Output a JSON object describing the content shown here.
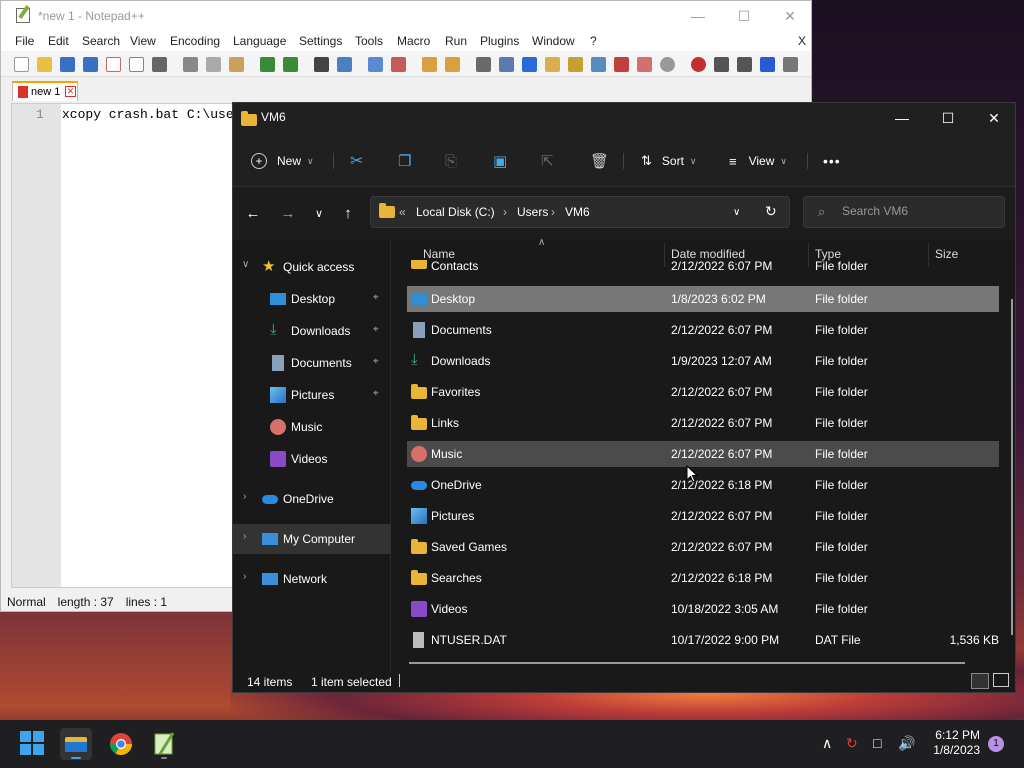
{
  "notepad": {
    "title": "*new 1 - Notepad++",
    "menu": [
      "File",
      "Edit",
      "Search",
      "View",
      "Encoding",
      "Language",
      "Settings",
      "Tools",
      "Macro",
      "Run",
      "Plugins",
      "Window",
      "?"
    ],
    "menu_close": "X",
    "tab_label": "new 1",
    "line_number": "1",
    "code": "xcopy crash.bat C:\\use",
    "status_mode": "Normal",
    "status_length": "length : 37",
    "status_lines": "lines : 1"
  },
  "explorer": {
    "title": "VM6",
    "toolbar": {
      "new_label": "New",
      "sort_label": "Sort",
      "view_label": "View",
      "more_label": "•••"
    },
    "breadcrumb": {
      "chevron": "«",
      "parts": [
        "Local Disk (C:)",
        "Users",
        "VM6"
      ]
    },
    "search_placeholder": "Search VM6",
    "columns": {
      "name": "Name",
      "date": "Date modified",
      "type": "Type",
      "size": "Size"
    },
    "nav": {
      "quick_access": "Quick access",
      "items": [
        "Desktop",
        "Downloads",
        "Documents",
        "Pictures",
        "Music",
        "Videos"
      ],
      "onedrive": "OneDrive",
      "my_computer": "My Computer",
      "network": "Network"
    },
    "files": [
      {
        "name": "Contacts",
        "date": "2/12/2022 6:07 PM",
        "type": "File folder",
        "size": ""
      },
      {
        "name": "Desktop",
        "date": "1/8/2023 6:02 PM",
        "type": "File folder",
        "size": ""
      },
      {
        "name": "Documents",
        "date": "2/12/2022 6:07 PM",
        "type": "File folder",
        "size": ""
      },
      {
        "name": "Downloads",
        "date": "1/9/2023 12:07 AM",
        "type": "File folder",
        "size": ""
      },
      {
        "name": "Favorites",
        "date": "2/12/2022 6:07 PM",
        "type": "File folder",
        "size": ""
      },
      {
        "name": "Links",
        "date": "2/12/2022 6:07 PM",
        "type": "File folder",
        "size": ""
      },
      {
        "name": "Music",
        "date": "2/12/2022 6:07 PM",
        "type": "File folder",
        "size": ""
      },
      {
        "name": "OneDrive",
        "date": "2/12/2022 6:18 PM",
        "type": "File folder",
        "size": ""
      },
      {
        "name": "Pictures",
        "date": "2/12/2022 6:07 PM",
        "type": "File folder",
        "size": ""
      },
      {
        "name": "Saved Games",
        "date": "2/12/2022 6:07 PM",
        "type": "File folder",
        "size": ""
      },
      {
        "name": "Searches",
        "date": "2/12/2022 6:18 PM",
        "type": "File folder",
        "size": ""
      },
      {
        "name": "Videos",
        "date": "10/18/2022 3:05 AM",
        "type": "File folder",
        "size": ""
      },
      {
        "name": "NTUSER.DAT",
        "date": "10/17/2022 9:00 PM",
        "type": "DAT File",
        "size": "1,536 KB"
      }
    ],
    "status": {
      "items": "14 items",
      "selected": "1 item selected"
    }
  },
  "taskbar": {
    "time": "6:12 PM",
    "date": "1/8/2023",
    "notification_count": "1"
  },
  "colors": {
    "explorer_bg": "#191919",
    "selected_row": "#777777",
    "hover_row": "#4b4b4b",
    "folder": "#e9b535",
    "npp_tab_accent": "#f7a400"
  }
}
